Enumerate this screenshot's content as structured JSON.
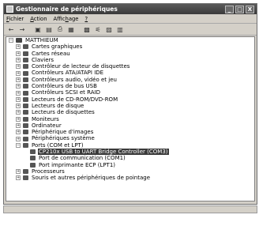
{
  "window": {
    "title": "Gestionnaire de périphériques",
    "controls": {
      "minimize": "_",
      "maximize": "□",
      "close": "X"
    }
  },
  "menu": {
    "file": {
      "mnemonic": "F",
      "rest": "ichier"
    },
    "action": {
      "mnemonic": "A",
      "rest": "ction"
    },
    "view": {
      "prefix": "Affic",
      "mnemonic": "h",
      "rest": "age"
    },
    "help": {
      "mnemonic": "?"
    }
  },
  "toolbar": [
    "back-icon",
    "forward-icon",
    "up-icon",
    "properties-icon",
    "print-icon",
    "help-icon",
    "scan-icon",
    "update-icon",
    "uninstall-icon",
    "disable-icon"
  ],
  "tree": {
    "root": "MATTHIEUM",
    "categories": [
      {
        "label": "Cartes graphiques",
        "expanded": false
      },
      {
        "label": "Cartes réseau",
        "expanded": false
      },
      {
        "label": "Claviers",
        "expanded": false
      },
      {
        "label": "Contrôleur de lecteur de disquettes",
        "expanded": false
      },
      {
        "label": "Contrôleurs ATA/ATAPI IDE",
        "expanded": false
      },
      {
        "label": "Contrôleurs audio, vidéo et jeu",
        "expanded": false
      },
      {
        "label": "Contrôleurs de bus USB",
        "expanded": false
      },
      {
        "label": "Contrôleurs SCSI et RAID",
        "expanded": false
      },
      {
        "label": "Lecteurs de CD-ROM/DVD-ROM",
        "expanded": false
      },
      {
        "label": "Lecteurs de disque",
        "expanded": false
      },
      {
        "label": "Lecteurs de disquettes",
        "expanded": false
      },
      {
        "label": "Moniteurs",
        "expanded": false
      },
      {
        "label": "Ordinateur",
        "expanded": false
      },
      {
        "label": "Périphérique d'images",
        "expanded": false
      },
      {
        "label": "Périphériques système",
        "expanded": false
      },
      {
        "label": "Ports (COM et LPT)",
        "expanded": true,
        "children": [
          {
            "label": "CP210x USB to UART Bridge Controller (COM3)",
            "selected": true
          },
          {
            "label": "Port de communication (COM1)",
            "selected": false
          },
          {
            "label": "Port imprimante ECP (LPT1)",
            "selected": false
          }
        ]
      },
      {
        "label": "Processeurs",
        "expanded": false
      },
      {
        "label": "Souris et autres périphériques de pointage",
        "expanded": false
      }
    ]
  }
}
